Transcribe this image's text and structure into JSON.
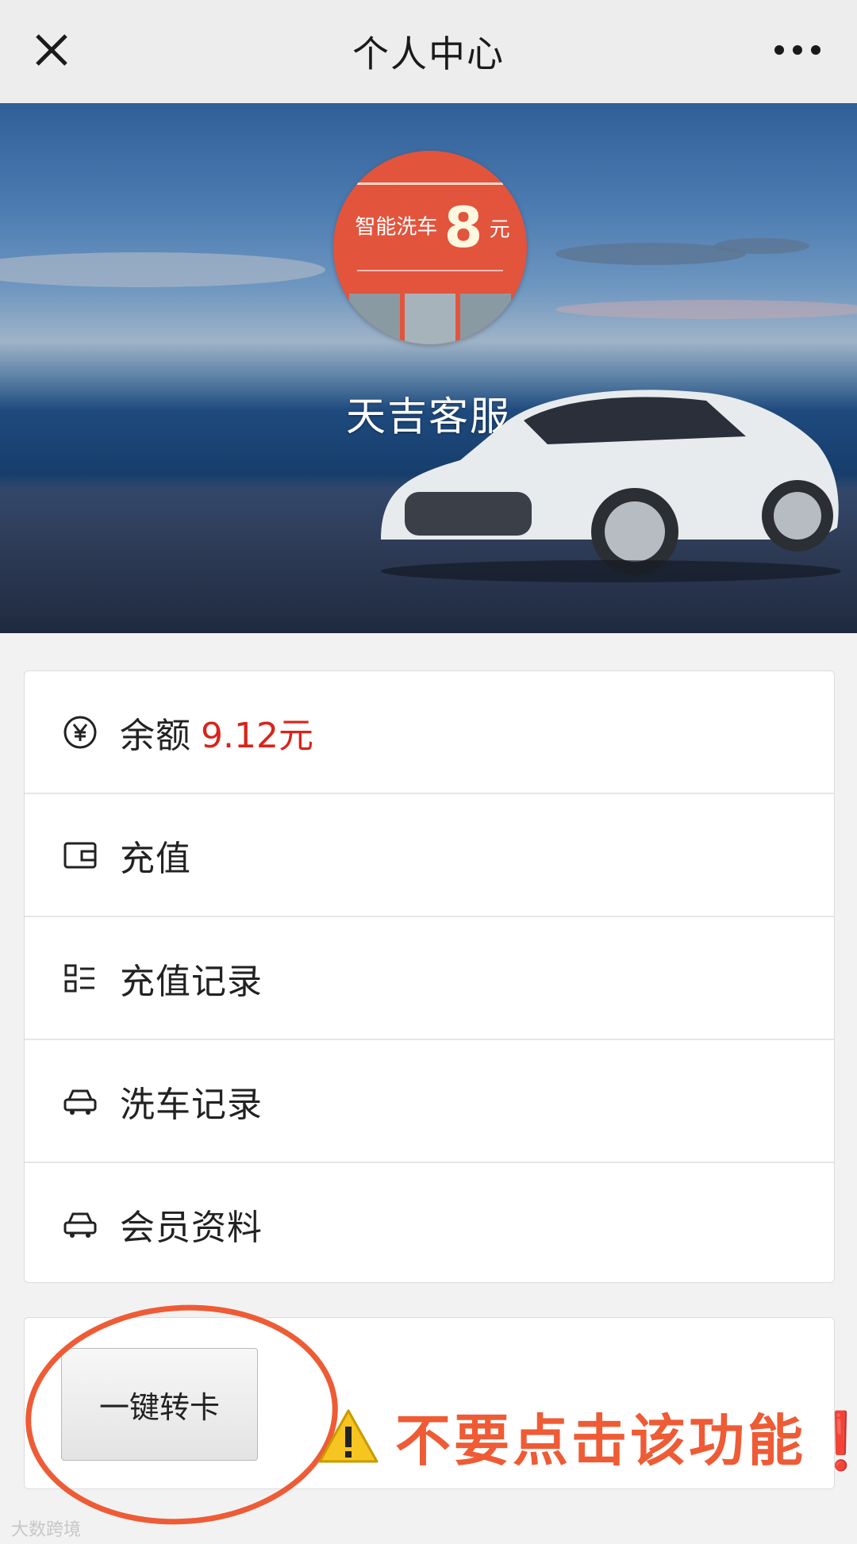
{
  "topbar": {
    "title": "个人中心",
    "close_icon": "close-icon",
    "more_icon": "more-dots-icon"
  },
  "banner": {
    "username": "天吉客服",
    "avatar": {
      "headline": "智能洗车",
      "big_number": "8",
      "unit": "元"
    }
  },
  "menu": {
    "items": [
      {
        "label": "余额",
        "value": "9.12元",
        "icon": "yen-coin-icon"
      },
      {
        "label": "充值",
        "icon": "wallet-icon"
      },
      {
        "label": "充值记录",
        "icon": "list-icon"
      },
      {
        "label": "洗车记录",
        "icon": "car-icon"
      },
      {
        "label": "会员资料",
        "icon": "car-icon"
      }
    ]
  },
  "bottom": {
    "transfer_button": "一键转卡",
    "warning_text": "不要点击该功能❗",
    "warning_icon": "warning-triangle-icon"
  },
  "watermark": "大数跨境",
  "colors": {
    "accent_red": "#d9241b",
    "annotation_orange": "#ee5b35"
  }
}
